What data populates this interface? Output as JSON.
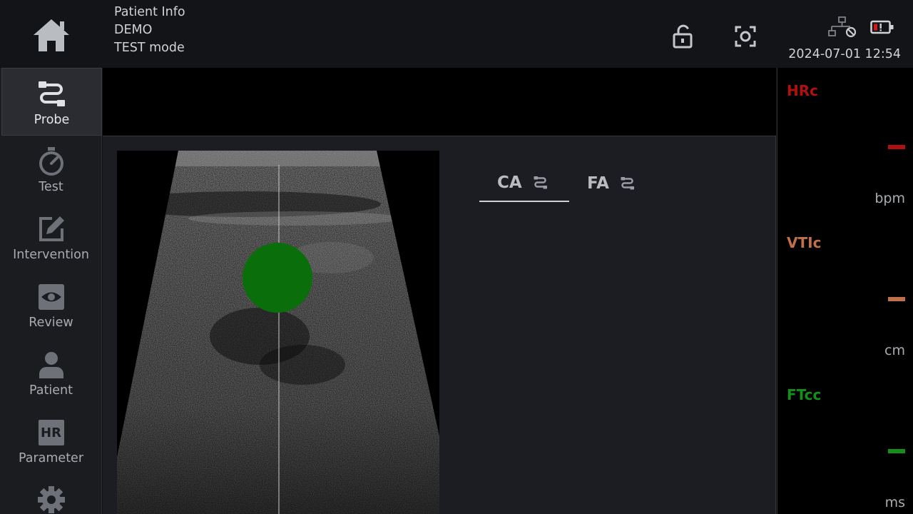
{
  "header": {
    "patient_info_title": "Patient Info",
    "patient_name": "DEMO",
    "mode": "TEST mode",
    "datetime": "2024-07-01 12:54"
  },
  "icons": {
    "home": "home-icon",
    "lock": "unlock-icon",
    "capture": "screenshot-icon",
    "network": "network-disconnected-icon",
    "battery": "battery-low-icon"
  },
  "sidebar": {
    "items": [
      {
        "label": "Probe",
        "icon": "probe-icon",
        "active": true
      },
      {
        "label": "Test",
        "icon": "stopwatch-icon",
        "active": false
      },
      {
        "label": "Intervention",
        "icon": "edit-icon",
        "active": false
      },
      {
        "label": "Review",
        "icon": "eye-icon",
        "active": false
      },
      {
        "label": "Patient",
        "icon": "person-icon",
        "active": false
      },
      {
        "label": "Parameter",
        "icon": "hr-icon",
        "active": false
      },
      {
        "label": "",
        "icon": "gear-icon",
        "active": false
      }
    ],
    "parameter_icon_text": "HR"
  },
  "tabs": [
    {
      "label": "CA",
      "icon": "probe-icon",
      "selected": true
    },
    {
      "label": "FA",
      "icon": "probe-icon",
      "selected": false
    }
  ],
  "parameters": [
    {
      "name": "HRc",
      "value": "–",
      "unit": "bpm",
      "color": "#b01010"
    },
    {
      "name": "VTIc",
      "value": "–",
      "unit": "cm",
      "color": "#c0704a"
    },
    {
      "name": "FTcc",
      "value": "–",
      "unit": "ms",
      "color": "#14901a"
    }
  ],
  "colors": {
    "background": "#111215",
    "panel": "#1c1d22",
    "vessel_marker": "#0a6e0a"
  }
}
